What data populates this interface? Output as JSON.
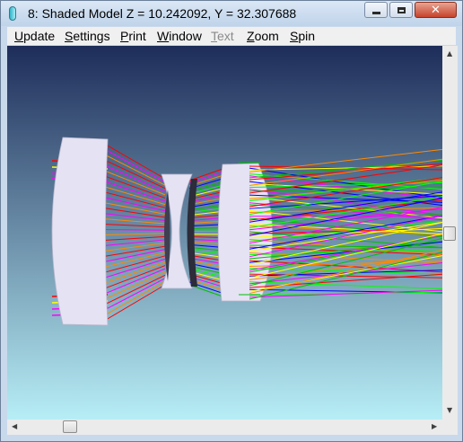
{
  "window": {
    "title": "8: Shaded Model Z = 10.242092, Y = 32.307688",
    "icon": "app-icon",
    "controls": {
      "minimize": "minimize-icon",
      "maximize": "maximize-icon",
      "close": "close-icon",
      "close_glyph": "✕"
    }
  },
  "menu": [
    {
      "id": "update",
      "first": "U",
      "rest": "pdate",
      "enabled": true
    },
    {
      "id": "settings",
      "first": "S",
      "rest": "ettings",
      "enabled": true
    },
    {
      "id": "print",
      "first": "P",
      "rest": "rint",
      "enabled": true
    },
    {
      "id": "window",
      "first": "W",
      "rest": "indow",
      "enabled": true
    },
    {
      "id": "text",
      "first": "T",
      "rest": "ext",
      "enabled": false
    },
    {
      "id": "zoom",
      "first": "Z",
      "rest": "oom",
      "enabled": true
    },
    {
      "id": "spin",
      "first": "S",
      "rest": "pin",
      "enabled": true
    }
  ],
  "viewport": {
    "background_top": "#1e2d5a",
    "background_bottom": "#b7eef6",
    "lens_color": "#e4e2f3",
    "ray_colors": [
      "#ff0000",
      "#ff00ff",
      "#ff8a00",
      "#0000ff",
      "#00c000",
      "#00ff00",
      "#ffff00"
    ]
  },
  "scrollbars": {
    "up_arrow": "▲",
    "down_arrow": "▼",
    "left_arrow": "◀",
    "right_arrow": "▶"
  }
}
